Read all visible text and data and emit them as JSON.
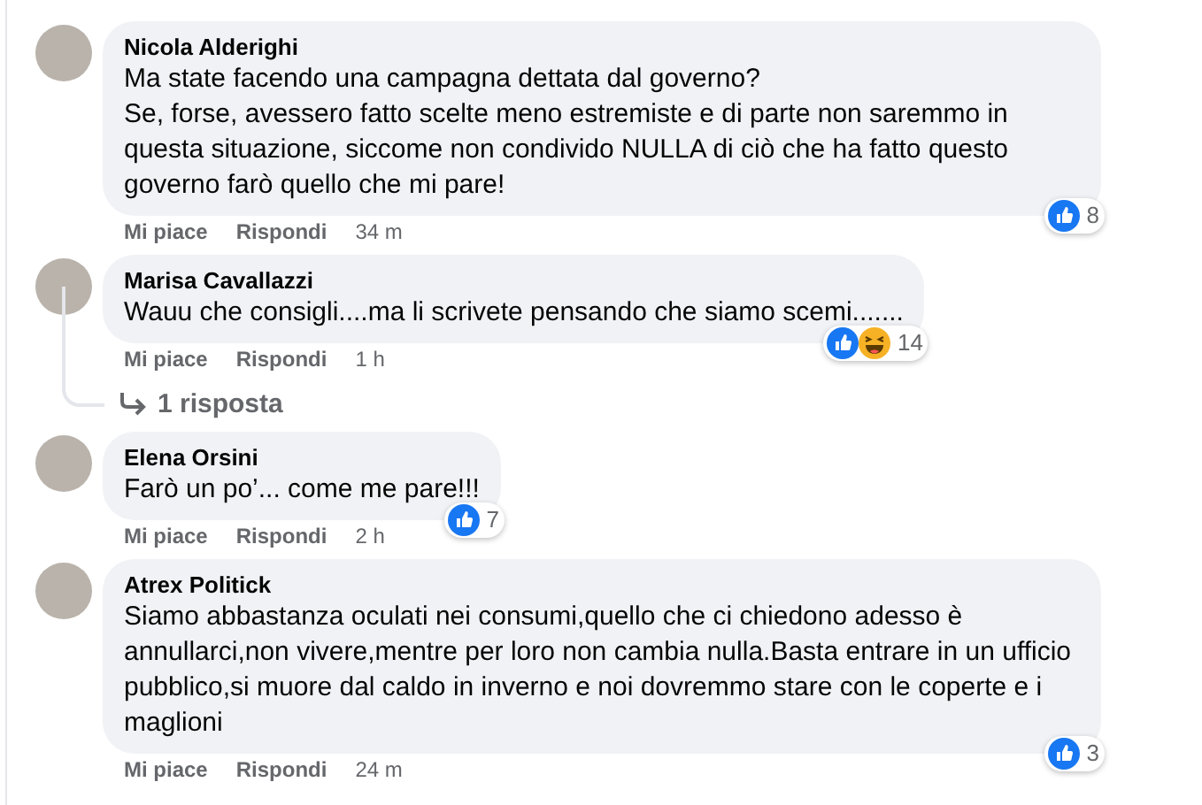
{
  "comments": [
    {
      "author": "Nicola Alderighi",
      "text": "Ma state facendo una campagna dettata dal governo?\nSe, forse, avessero fatto scelte meno estremiste e di parte non saremmo in questa situazione, siccome non condivido NULLA di ciò che ha fatto questo governo farò quello che mi pare!",
      "reactions": [
        {
          "kind": "like"
        }
      ],
      "reaction_count": "8",
      "actions": [
        "Mi piace",
        "Rispondi"
      ],
      "time": "34 m"
    },
    {
      "author": "Marisa Cavallazzi",
      "text": "Wauu che consigli....ma li scrivete pensando che siamo scemi.......",
      "reactions": [
        {
          "kind": "like"
        },
        {
          "kind": "haha"
        }
      ],
      "reaction_count": "14",
      "actions": [
        "Mi piace",
        "Rispondi"
      ],
      "time": "1 h",
      "replies_link": "1 risposta"
    },
    {
      "author": "Elena Orsini",
      "text": "Farò un po’... come me pare!!!",
      "reactions": [
        {
          "kind": "like"
        }
      ],
      "reaction_count": "7",
      "actions": [
        "Mi piace",
        "Rispondi"
      ],
      "time": "2 h"
    },
    {
      "author": "Atrex Politick",
      "text": "Siamo abbastanza oculati nei consumi,quello che ci chiedono adesso è annullarci,non vivere,mentre per loro non cambia nulla.Basta entrare in un ufficio pubblico,si muore dal caldo in inverno e noi dovremmo stare con le coperte e i maglioni",
      "reactions": [
        {
          "kind": "like"
        }
      ],
      "reaction_count": "3",
      "actions": [
        "Mi piace",
        "Rispondi"
      ],
      "time": "24 m"
    }
  ]
}
